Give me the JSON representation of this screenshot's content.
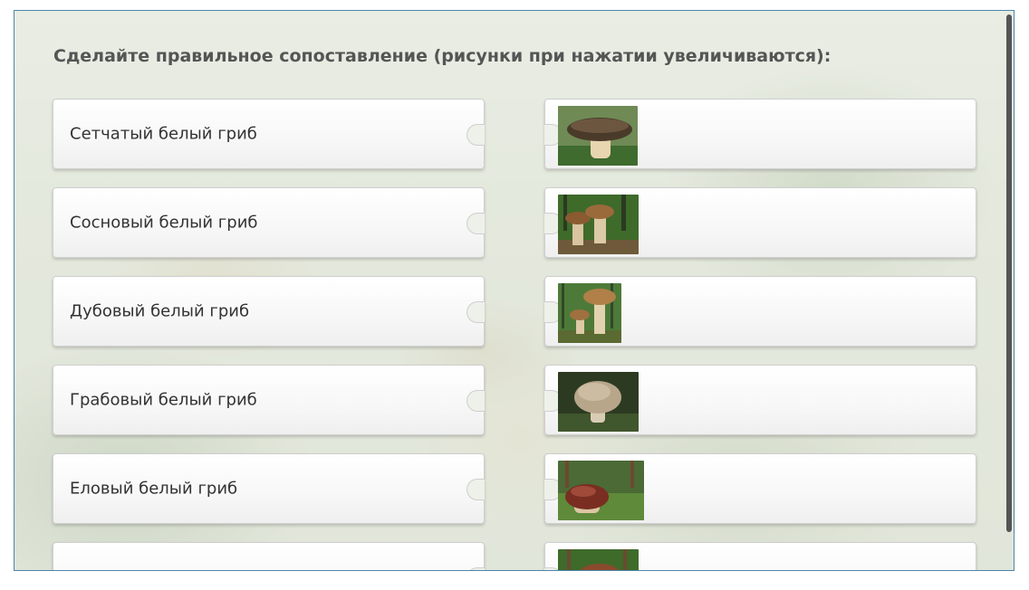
{
  "task": {
    "title": "Сделайте правильное сопоставление (рисунки при нажатии увеличиваются):"
  },
  "left_items": [
    {
      "label": "Сетчатый белый гриб"
    },
    {
      "label": "Сосновый белый гриб"
    },
    {
      "label": "Дубовый белый гриб"
    },
    {
      "label": "Грабовый белый гриб"
    },
    {
      "label": "Еловый белый гриб"
    },
    {
      "label": ""
    }
  ],
  "right_items": [
    {
      "image": "mushroom-photo-1"
    },
    {
      "image": "mushroom-photo-2"
    },
    {
      "image": "mushroom-photo-3"
    },
    {
      "image": "mushroom-photo-4"
    },
    {
      "image": "mushroom-photo-5"
    },
    {
      "image": "mushroom-photo-6"
    }
  ],
  "colors": {
    "frame_border": "#4e86a8",
    "title_text": "#555555",
    "card_border": "#cfcfcf",
    "scrollbar": "#555555"
  }
}
